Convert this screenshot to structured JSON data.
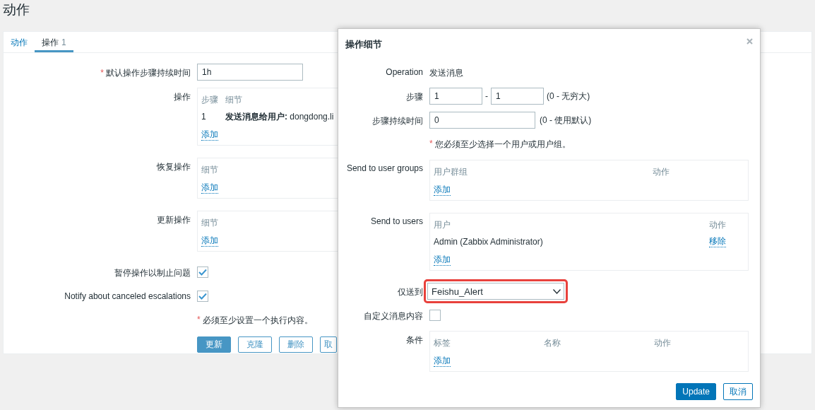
{
  "page": {
    "title": "动作"
  },
  "tabs": [
    {
      "label": "动作",
      "selected": false
    },
    {
      "label": "操作",
      "count": "1",
      "selected": true
    }
  ],
  "form": {
    "rows": [
      {
        "kind": "input",
        "label": "默认操作步骤持续时间",
        "required_mark": "*",
        "value": "1h"
      },
      {
        "kind": "table",
        "label": "操作",
        "columns": [
          "步骤",
          "细节"
        ],
        "rows": [
          {
            "cells": [
              "1",
              "**发送消息给用户:** dongdong.li"
            ]
          }
        ],
        "add": "添加"
      },
      {
        "kind": "table",
        "label": "恢复操作",
        "columns": [
          "细节"
        ],
        "add": "添加"
      },
      {
        "kind": "table",
        "label": "更新操作",
        "columns": [
          "细节"
        ],
        "add": "添加"
      },
      {
        "kind": "checkbox",
        "label": "暂停操作以制止问题",
        "checked": true
      },
      {
        "kind": "checkbox",
        "label": "Notify about canceled escalations",
        "checked": true
      },
      {
        "kind": "note",
        "required_mark": "*",
        "text": "必须至少设置一个执行内容。"
      },
      {
        "kind": "buttons",
        "buttons": [
          {
            "label": "更新",
            "primary": true
          },
          {
            "label": "克隆",
            "primary": false
          },
          {
            "label": "删除",
            "primary": false
          },
          {
            "label": "取",
            "primary": false
          }
        ]
      }
    ]
  },
  "dialog": {
    "title": "操作细节",
    "rows": [
      {
        "kind": "text",
        "label": "Operation",
        "value": "发送消息"
      },
      {
        "kind": "range",
        "label": "步骤",
        "from": "1",
        "separator": "-",
        "to": "1",
        "hint": "(0 - 无穷大)"
      },
      {
        "kind": "input",
        "label": "步骤持续时间",
        "value": "0",
        "hint": "(0 - 使用默认)"
      },
      {
        "kind": "note",
        "required_mark": "*",
        "text": "您必须至少选择一个用户或用户组。"
      },
      {
        "kind": "table",
        "label": "Send to user groups",
        "columns": [
          "用户群组",
          "动作"
        ],
        "add": "添加"
      },
      {
        "kind": "table",
        "label": "Send to users",
        "columns": [
          "用户",
          "动作"
        ],
        "rows": [
          {
            "cells": [
              "Admin (Zabbix Administrator)"
            ],
            "action": "移除"
          }
        ],
        "add": "添加"
      },
      {
        "kind": "select",
        "label": "仅送到",
        "value": "Feishu_Alert",
        "highlighted": true
      },
      {
        "kind": "checkbox",
        "label": "自定义消息内容",
        "checked": false
      },
      {
        "kind": "table",
        "label": "条件",
        "columns": [
          "标签",
          "名称",
          "动作"
        ],
        "add": "添加"
      }
    ],
    "buttons": [
      {
        "label": "Update",
        "primary": true
      },
      {
        "label": "取消",
        "primary": false
      }
    ]
  }
}
